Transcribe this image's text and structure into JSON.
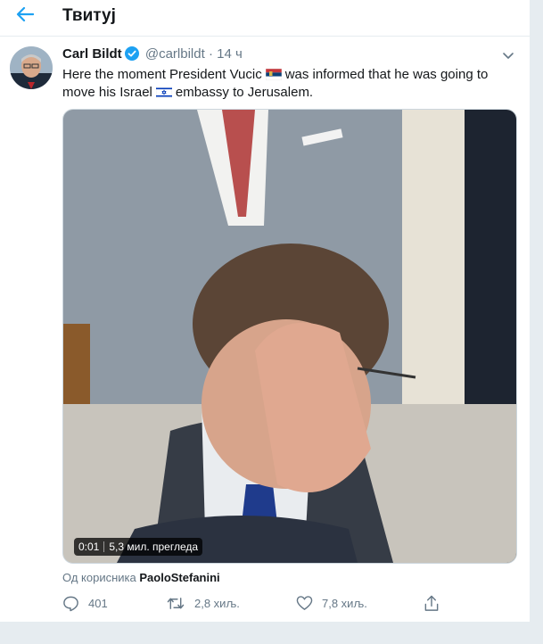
{
  "header": {
    "title": "Твитуј"
  },
  "tweet": {
    "author_name": "Carl Bildt",
    "handle": "@carlbildt",
    "dot": "·",
    "time": "14 ч",
    "text_part1": "Here the moment President Vucic",
    "text_part2": "was informed that he was going to move his Israel",
    "text_part3": "embassy to Jerusalem."
  },
  "video": {
    "duration": "0:01",
    "views": "5,3 мил. прегледа"
  },
  "attribution": {
    "prefix": "Од корисника",
    "user": "PaoloStefanini"
  },
  "actions": {
    "replies": "401",
    "retweets": "2,8 хиљ.",
    "likes": "7,8 хиљ."
  },
  "colors": {
    "accent": "#1da1f2",
    "muted": "#657786"
  },
  "icons": [
    "back-arrow-icon",
    "verified-icon",
    "caret-down-icon",
    "serbia-flag-icon",
    "israel-flag-icon",
    "reply-icon",
    "retweet-icon",
    "like-icon",
    "share-icon"
  ]
}
